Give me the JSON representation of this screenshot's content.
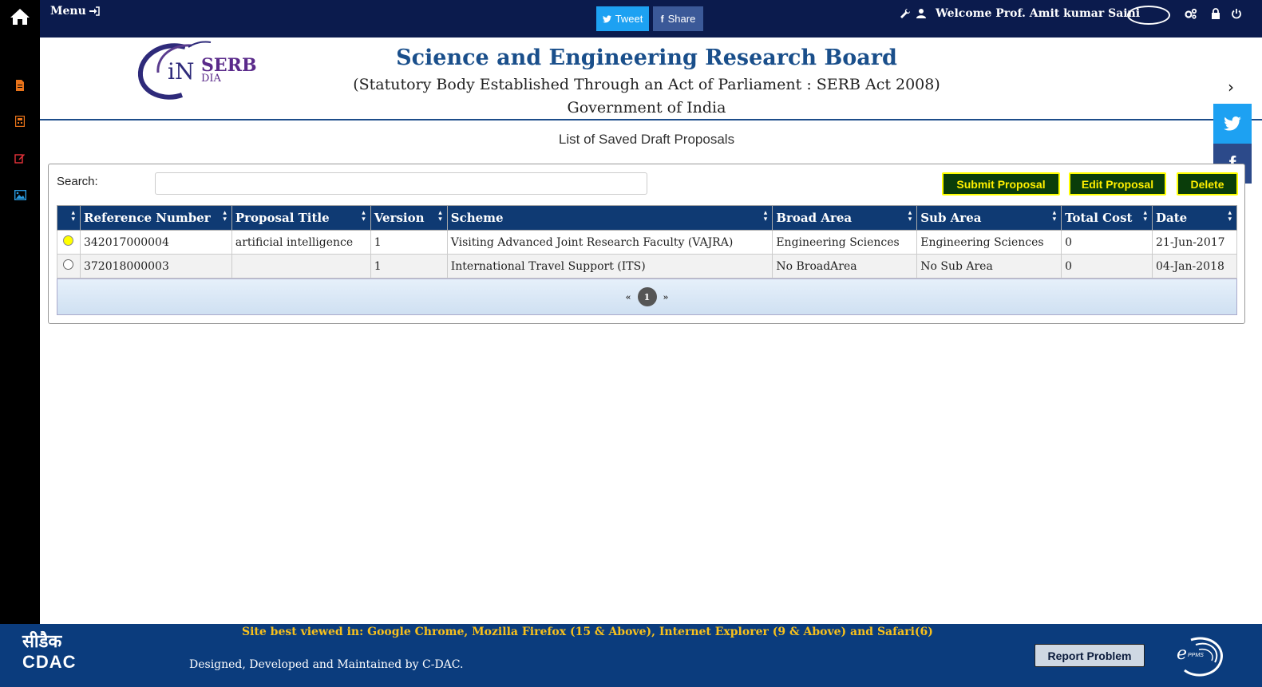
{
  "topbar": {
    "menu_label": "Menu",
    "tweet_label": "Tweet",
    "share_label": "Share",
    "welcome_text": "Welcome Prof. Amit kumar Saini"
  },
  "header": {
    "logo_text_1": "SERB",
    "logo_text_2": "iN",
    "logo_text_3": "DIA",
    "title": "Science and Engineering Research Board",
    "subtitle": "(Statutory Body Established Through an Act of Parliament : SERB Act 2008)",
    "government": "Government of India"
  },
  "page": {
    "title": "List of Saved Draft Proposals",
    "search_label": "Search:",
    "search_value": "",
    "buttons": {
      "submit": "Submit Proposal",
      "edit": "Edit Proposal",
      "delete": "Delete"
    }
  },
  "table": {
    "columns": [
      "",
      "Reference Number",
      "Proposal Title",
      "Version",
      "Scheme",
      "Broad Area",
      "Sub Area",
      "Total Cost",
      "Date"
    ],
    "rows": [
      {
        "selected": true,
        "ref": "342017000004",
        "title": "artificial intelligence",
        "version": "1",
        "scheme": "Visiting Advanced Joint Research Faculty (VAJRA)",
        "broad": "Engineering Sciences",
        "sub": "Engineering Sciences",
        "cost": "0",
        "date": "21-Jun-2017"
      },
      {
        "selected": false,
        "ref": "372018000003",
        "title": "",
        "version": "1",
        "scheme": "International Travel Support (ITS)",
        "broad": "No BroadArea",
        "sub": "No Sub Area",
        "cost": "0",
        "date": "04-Jan-2018"
      }
    ],
    "pager": {
      "prev": "«",
      "current": "1",
      "next": "»"
    }
  },
  "footer": {
    "cdac_hindi": "सीडैक",
    "cdac_label": "CDAC",
    "best_viewed": "Site best viewed in: Google Chrome, Mozilla Firefox (15 & Above), Internet Explorer (9 & Above) and Safari(6)",
    "designed_by": "Designed, Developed and Maintained by C-DAC.",
    "report_label": "Report Problem",
    "eppms_label": "PPMS"
  },
  "colors": {
    "topbar": "#0b1b4d",
    "table_header": "#0f3a73",
    "footer": "#0b3c7d",
    "action_button_bg": "#0a3d0a",
    "action_button_text": "#ffef00"
  }
}
